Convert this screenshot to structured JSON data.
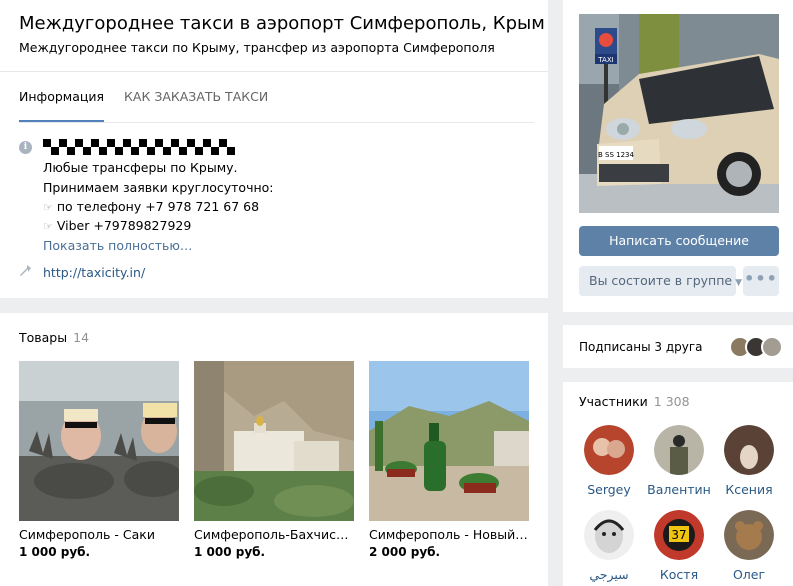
{
  "group": {
    "title": "Междугороднее такси в аэропорт Симферополь, Крым",
    "status": "Междугороднее такси по Крыму, трансфер из аэропорта Симферополя"
  },
  "tabs": [
    {
      "label": "Информация",
      "active": true
    },
    {
      "label": "КАК ЗАКАЗАТЬ ТАКСИ",
      "active": false
    }
  ],
  "info": {
    "lines": [
      "Любые трансферы по Крыму.",
      "Принимаем заявки круглосуточно:",
      "по телефону +7 978 721 67 68",
      "Viber +79789827929"
    ],
    "finger_glyph": "☞",
    "show_more": "Показать полностью…",
    "site": "http://taxicity.in/",
    "icons": [
      "info-icon",
      "link-arrow-icon",
      "pointing-finger-icon"
    ]
  },
  "goods": {
    "title": "Товары",
    "count": "14",
    "items": [
      {
        "name": "Симферополь - Саки",
        "price": "1 000 руб."
      },
      {
        "name": "Симферополь-Бахчисарай",
        "price": "1 000 руб."
      },
      {
        "name": "Симферополь - Новый Свет",
        "price": "2 000 руб."
      }
    ]
  },
  "sidebar": {
    "write_message": "Написать сообщение",
    "membership": "Вы состоите в группе",
    "more_label": "•••",
    "friends_text": "Подписаны 3 друга",
    "members_title": "Участники",
    "members_count": "1 308",
    "members": [
      {
        "name": "Sergey"
      },
      {
        "name": "Валентин"
      },
      {
        "name": "Ксения"
      },
      {
        "name": "سيرجي"
      },
      {
        "name": "Костя"
      },
      {
        "name": "Олег"
      }
    ],
    "taxi_sign": "TAXI",
    "plate_text": "B SS 1234"
  },
  "colors": {
    "accent_button": "#5e81a8",
    "link": "#2a5885",
    "background": "#edeef0"
  }
}
